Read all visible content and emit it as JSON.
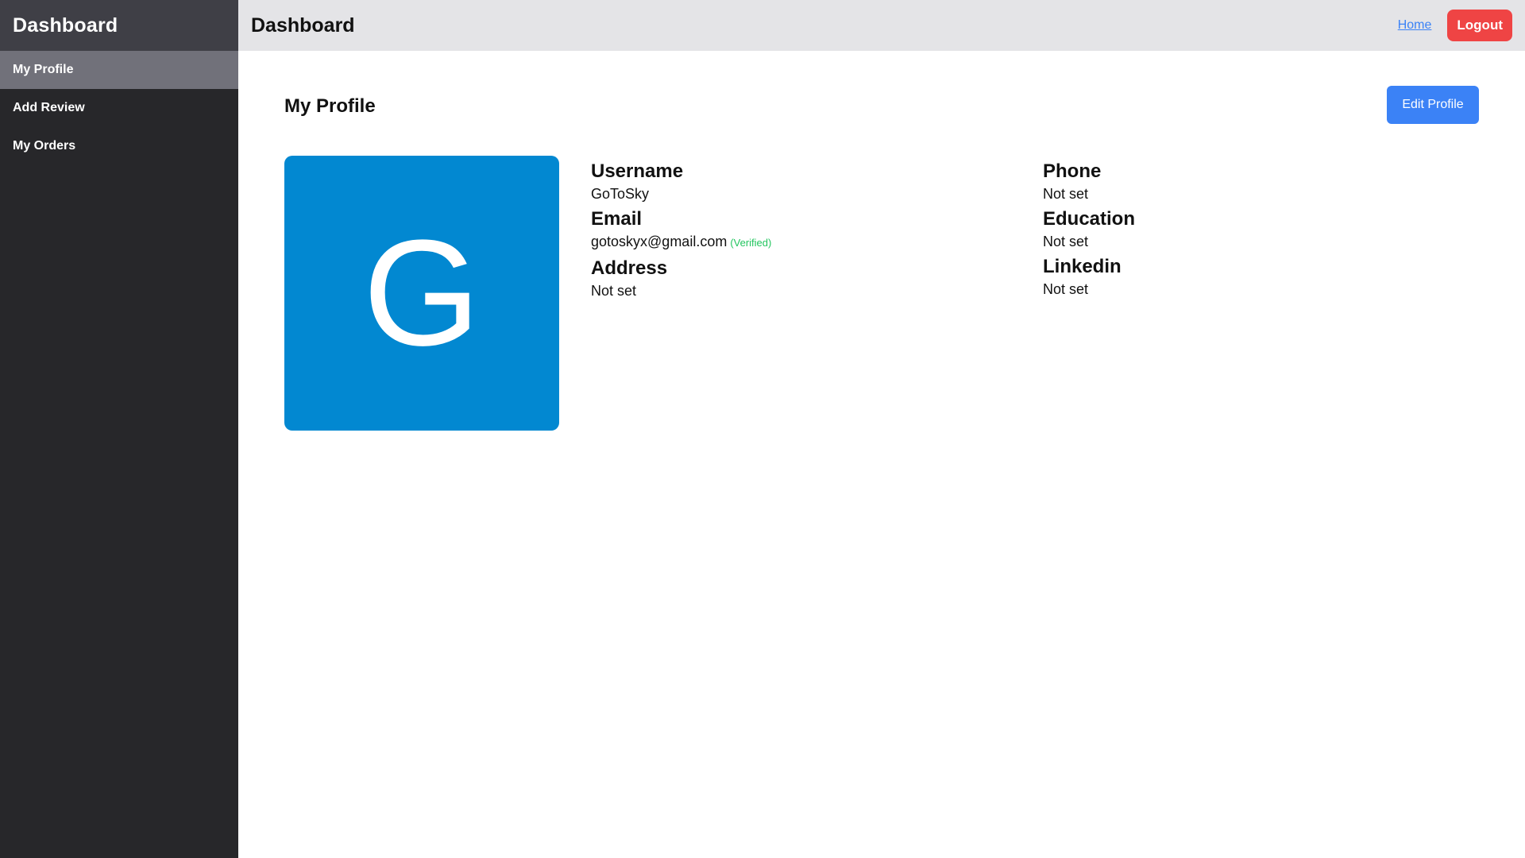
{
  "sidebar": {
    "title": "Dashboard",
    "items": [
      {
        "label": "My Profile",
        "active": true
      },
      {
        "label": "Add Review",
        "active": false
      },
      {
        "label": "My Orders",
        "active": false
      }
    ]
  },
  "topbar": {
    "title": "Dashboard",
    "home_label": "Home",
    "logout_label": "Logout"
  },
  "profile": {
    "page_title": "My Profile",
    "edit_label": "Edit Profile",
    "avatar_letter": "G",
    "avatar_color": "#0288d1",
    "fields": {
      "username": {
        "label": "Username",
        "value": "GoToSky"
      },
      "email": {
        "label": "Email",
        "value": "gotoskyx@gmail.com",
        "badge": "(Verified)"
      },
      "address": {
        "label": "Address",
        "value": "Not set"
      },
      "phone": {
        "label": "Phone",
        "value": "Not set"
      },
      "education": {
        "label": "Education",
        "value": "Not set"
      },
      "linkedin": {
        "label": "Linkedin",
        "value": "Not set"
      }
    }
  },
  "colors": {
    "sidebar_bg": "#27272a",
    "sidebar_active": "#71717a",
    "topbar_bg": "#e4e4e7",
    "logout": "#ef4444",
    "primary": "#3b82f6",
    "verified": "#22c55e"
  }
}
